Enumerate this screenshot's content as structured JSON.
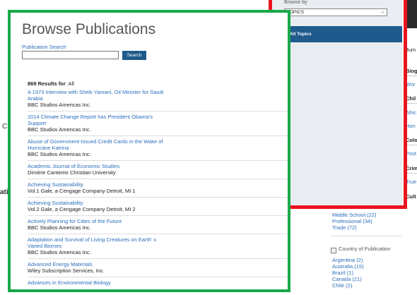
{
  "background": {
    "fragment_a": "C",
    "fragment_b": "atio"
  },
  "green_panel": {
    "title": "Browse Publications",
    "search_label": "Publication Search",
    "search_value": "",
    "search_button": "Search",
    "results_count": "869 Results for",
    "results_query": "All",
    "items": [
      {
        "title": "A 1973 Interview with Sheik Yamani, Oil Minister for Saudi Arabia",
        "publisher": "BBC Studios Americas Inc."
      },
      {
        "title": "2014 Climate Change Report has President Obama's Support",
        "publisher": "BBC Studios Americas Inc."
      },
      {
        "title": "Abuse of Government-Issued Credit Cards in the Wake of Hurricane Katrina",
        "publisher": "BBC Studios Americas Inc."
      },
      {
        "title": "Academic Journal of Economic Studies",
        "publisher": "Dimitrie Cantemir Christian University"
      },
      {
        "title": "Achieving Sustainability",
        "publisher": "Vol.1 Gale, a Cengage Company Detroit, MI 1"
      },
      {
        "title": "Achieving Sustainability",
        "publisher": "Vol.2 Gale, a Cengage Company Detroit, MI 2"
      },
      {
        "title": "Actively Planning for Cities of the Future",
        "publisher": "BBC Studios Americas Inc."
      },
      {
        "title": "Adaptation and Survival of Living Creatures on Earth' s Varied Biomes",
        "publisher": "BBC Studios Americas Inc."
      },
      {
        "title": "Advanced Energy Materials",
        "publisher": "Wiley Subscription Services, Inc."
      },
      {
        "title": "Advances in Environmental Biology",
        "publisher": ""
      }
    ]
  },
  "facets": {
    "audience": [
      "Middle School (22)",
      "Professional (34)",
      "Trade (72)"
    ],
    "country_header": "Country of Publication",
    "country_toggle": "−",
    "countries": [
      "Argentina (2)",
      "Australia (15)",
      "Brazil (1)",
      "Canada (21)",
      "Chile (2)"
    ]
  },
  "red_panel": {
    "browse_by_label": "Browse by",
    "select_value": "TOPICS",
    "chevron": "⌄",
    "selected_topic": "All Topics"
  },
  "right_strip": {
    "intro": "Jum",
    "sections": [
      {
        "header": "Biog",
        "links": [
          "Wor"
        ]
      },
      {
        "header": "Chil",
        "links": [
          "Afric",
          "Hon"
        ]
      },
      {
        "header": "Colo",
        "links": [
          "Post"
        ]
      },
      {
        "header": "Crim",
        "links": [
          "True"
        ]
      },
      {
        "header": "Cult",
        "links": []
      }
    ]
  }
}
